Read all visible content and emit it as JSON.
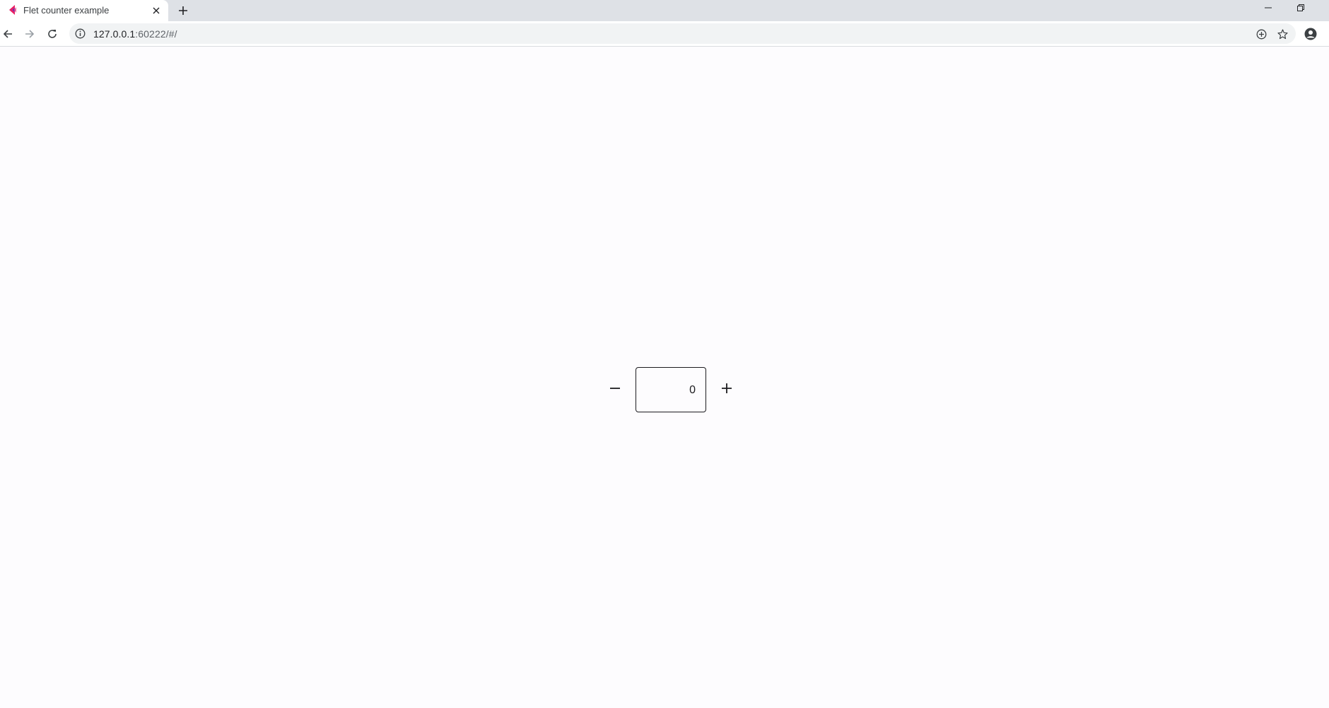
{
  "browser": {
    "tab": {
      "title": "Flet counter example",
      "favicon": "flet-logo-icon"
    },
    "address_bar": {
      "host": "127.0.0.1",
      "rest": ":60222/#/"
    }
  },
  "app": {
    "counter": {
      "value": "0",
      "decrement_icon": "remove-icon",
      "increment_icon": "add-icon"
    }
  },
  "colors": {
    "page_background": "#fdfcfe",
    "tabstrip_background": "#dee1e6",
    "field_border": "#1c1b1f"
  }
}
